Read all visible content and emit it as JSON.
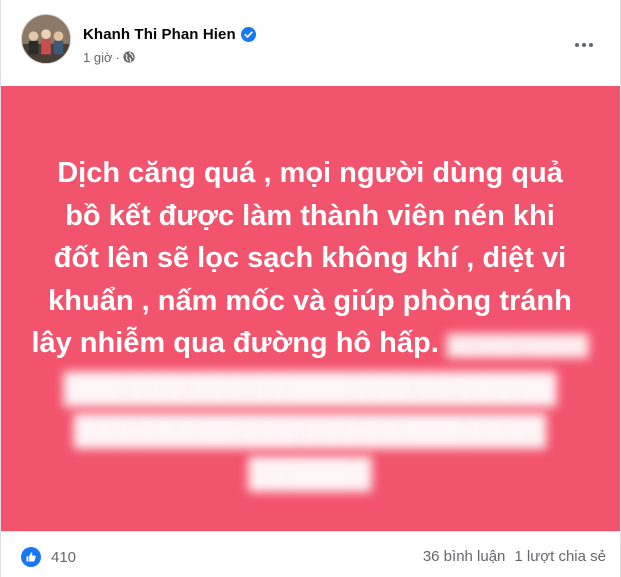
{
  "post": {
    "author": "Khanh Thi Phan Hien",
    "time": "1 giờ",
    "meta_dot": "·",
    "body_lines": [
      "Dịch căng quá , mọi người dùng quả",
      "bồ kết được làm thành viên nén khi",
      "đốt lên sẽ lọc sạch không khí , diệt vi",
      "khuẩn , nấm mốc và giúp phòng tránh",
      "lây nhiễm qua đường hô hấp."
    ],
    "background_color": "#f2536d"
  },
  "footer": {
    "like_count": "410",
    "comments": "36 bình luận",
    "shares": "1 lượt chia sẻ"
  },
  "icons": {
    "verified": "verified-badge-icon",
    "globe": "globe-icon",
    "more": "more-options-icon",
    "like": "like-reaction-icon"
  },
  "colors": {
    "accent": "#1877f2",
    "text_secondary": "#65676b"
  }
}
